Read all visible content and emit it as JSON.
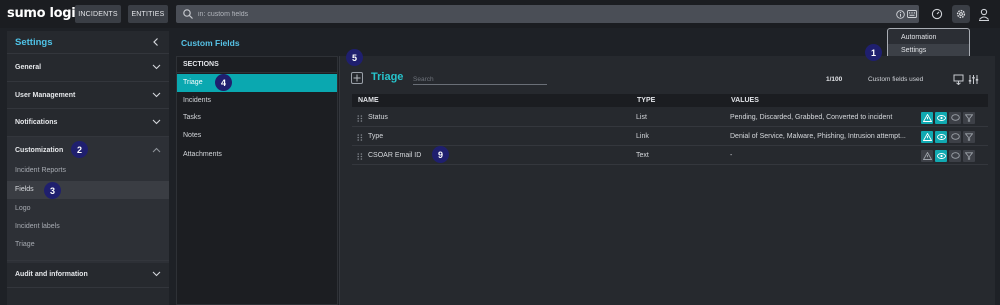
{
  "topbar": {
    "logo": "sumo logic",
    "incidents_label": "INCIDENTS",
    "entities_label": "ENTITIES",
    "search_placeholder": "in: custom fields"
  },
  "dropdown": {
    "items": [
      "Automation",
      "Settings"
    ],
    "selected": "Settings"
  },
  "sidebar": {
    "title": "Settings",
    "sections": [
      "General",
      "User Management",
      "Notifications",
      "Customization",
      "Audit and information"
    ],
    "customization_items": [
      "Incident Reports",
      "Fields",
      "Logo",
      "Incident labels",
      "Triage"
    ],
    "active_item": "Fields"
  },
  "main": {
    "page_title": "Custom Fields",
    "sections_header": "SECTIONS",
    "sections": [
      "Triage",
      "Incidents",
      "Tasks",
      "Notes",
      "Attachments"
    ],
    "active_section": "Triage",
    "panel_title": "Triage",
    "search_placeholder": "Search",
    "count": "1/100",
    "count_label": "Custom fields used",
    "columns": [
      "NAME",
      "TYPE",
      "VALUES"
    ],
    "rows": [
      {
        "name": "Status",
        "type": "List",
        "values": "Pending, Discarded, Grabbed, Converted to incident"
      },
      {
        "name": "Type",
        "type": "Link",
        "values": "Denial of Service, Malware, Phishing, Intrusion attempt..."
      },
      {
        "name": "CSOAR Email ID",
        "type": "Text",
        "values": "-"
      }
    ]
  },
  "markers": [
    "1",
    "2",
    "3",
    "4",
    "5",
    "9"
  ],
  "colors": {
    "accent": "#0aa8b0",
    "sidebar_title": "#4fc3e8",
    "page_title": "#56c2e6",
    "marker": "#1f1f6e"
  }
}
